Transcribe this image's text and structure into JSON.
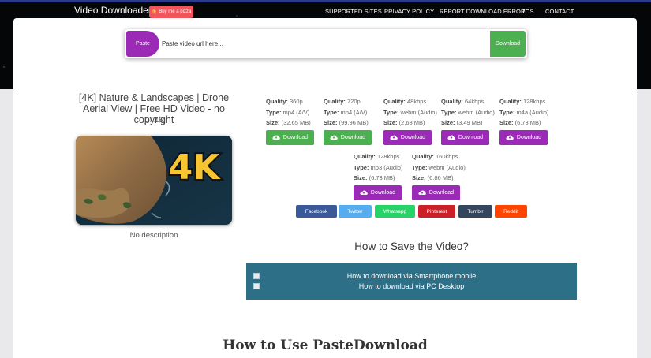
{
  "header": {
    "brand": "Video Downloader",
    "pizza_label": "Buy me a pizza",
    "nav": [
      "SUPPORTED SITES",
      "PRIVACY POLICY",
      "REPORT DOWNLOAD ERROR",
      "TOS",
      "CONTACT"
    ]
  },
  "search": {
    "paste_label": "Paste",
    "placeholder": "Paste video url here...",
    "download_label": "Download"
  },
  "video": {
    "title": "[4K] Nature & Landscapes | Drone Aerial View | Free HD Video - no copyright",
    "duration": "(07:16)",
    "thumbnail_text": "4K",
    "description": "No description"
  },
  "labels": {
    "quality": "Quality:",
    "type": "Type:",
    "size": "Size:"
  },
  "formats": [
    {
      "quality": "360p",
      "type": "mp4 (A/V)",
      "size": "(32.65 MB)",
      "button": "Download",
      "color": "#4caf50"
    },
    {
      "quality": "720p",
      "type": "mp4 (A/V)",
      "size": "(99.96 MB)",
      "button": "Download",
      "color": "#4caf50"
    },
    {
      "quality": "48kbps",
      "type": "webm (Audio)",
      "size": "(2.63 MB)",
      "button": "Download",
      "color": "#9b2ab6"
    },
    {
      "quality": "64kbps",
      "type": "webm (Audio)",
      "size": "(3.49 MB)",
      "button": "Download",
      "color": "#9b2ab6"
    },
    {
      "quality": "128kbps",
      "type": "m4a (Audio)",
      "size": "(6.73 MB)",
      "button": "Download",
      "color": "#9b2ab6"
    },
    {
      "quality": "128kbps",
      "type": "mp3 (Audio)",
      "size": "(6.73 MB)",
      "button": "Download",
      "color": "#9b2ab6"
    },
    {
      "quality": "160kbps",
      "type": "webm (Audio)",
      "size": "(6.86 MB)",
      "button": "Download",
      "color": "#9b2ab6"
    }
  ],
  "share": [
    {
      "label": "Facebook",
      "color": "#3b5998"
    },
    {
      "label": "Twitter",
      "color": "#55acee"
    },
    {
      "label": "Whatsapp",
      "color": "#25d366"
    },
    {
      "label": "Pinterest",
      "color": "#cb2027"
    },
    {
      "label": "Tumblr",
      "color": "#34465d"
    },
    {
      "label": "Reddit",
      "color": "#ff4500"
    }
  ],
  "howto": {
    "heading": "How to Save the Video?",
    "items": [
      "How to download via Smartphone mobile",
      "How to download via PC Desktop"
    ]
  },
  "bottom_heading": "How to Use PasteDownload"
}
